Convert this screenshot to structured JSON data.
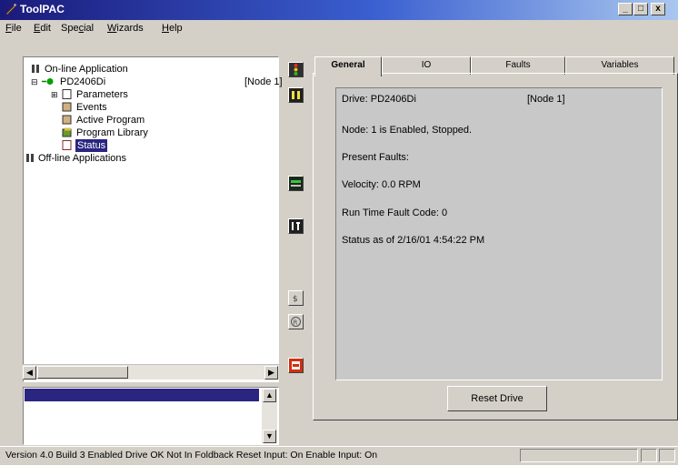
{
  "window": {
    "title": "ToolPAC",
    "min_label": "_",
    "max_label": "□",
    "close_label": "x"
  },
  "menu": [
    {
      "label": "File",
      "u": "F",
      "rest": "ile"
    },
    {
      "label": "Edit",
      "u": "E",
      "rest": "dit"
    },
    {
      "label": "Special",
      "pre": "Spe",
      "u": "c",
      "rest": "ial"
    },
    {
      "label": "Wizards",
      "u": "W",
      "rest": "izards"
    },
    {
      "label": "Help",
      "u": "H",
      "rest": "elp"
    }
  ],
  "tree": {
    "online": "On-line Application",
    "drive": "PD2406Di",
    "node": "[Node 1]",
    "children": [
      "Parameters",
      "Events",
      "Active Program",
      "Program Library",
      "Status"
    ],
    "offline": "Off-line Applications"
  },
  "tabs": [
    "General",
    "IO",
    "Faults",
    "Variables"
  ],
  "status": {
    "drive_label": "Drive: PD2406Di",
    "drive_node": "[Node 1]",
    "node_state": "Node: 1 is Enabled, Stopped.",
    "present_faults": "Present Faults:",
    "velocity": "Velocity: 0.0 RPM",
    "fault_code": "Run Time Fault Code: 0",
    "as_of": "Status as of 2/16/01 4:54:22 PM"
  },
  "reset_button": "Reset Drive",
  "statusbar": "Version 4.0 Build 3   Enabled   Drive OK   Not In Foldback   Reset Input: On   Enable Input: On",
  "colors": {
    "selection": "#2a2580",
    "titlebar_start": "#1a1a7a",
    "titlebar_end": "#a9c7ef",
    "status_bg": "#c8c8c8"
  }
}
